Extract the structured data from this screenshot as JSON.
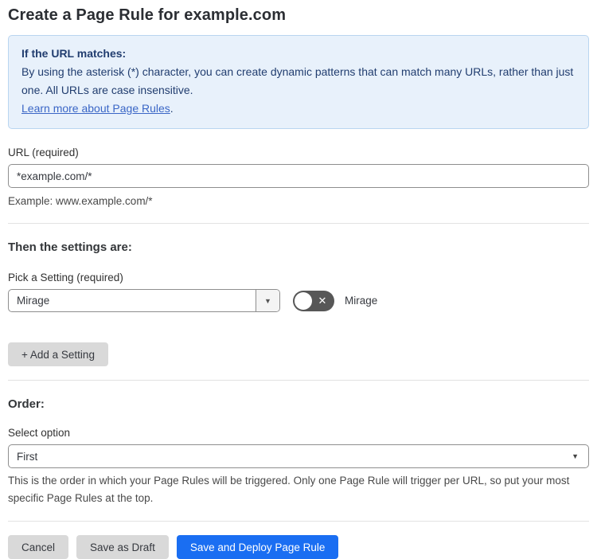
{
  "page": {
    "title": "Create a Page Rule for example.com"
  },
  "info_box": {
    "heading": "If the URL matches:",
    "body": "By using the asterisk (*) character, you can create dynamic patterns that can match many URLs, rather than just one. All URLs are case insensitive.",
    "link_label": "Learn more about Page Rules",
    "link_suffix": "."
  },
  "url_field": {
    "label": "URL (required)",
    "value": "*example.com/*",
    "helper": "Example: www.example.com/*"
  },
  "settings_section": {
    "heading": "Then the settings are:",
    "picker_label": "Pick a Setting (required)",
    "picker_value": "Mirage",
    "toggle_state": "off",
    "toggle_glyph": "✕",
    "toggle_label": "Mirage",
    "add_button_label": "+ Add a Setting"
  },
  "order_section": {
    "heading": "Order:",
    "select_label": "Select option",
    "select_value": "First",
    "helper": "This is the order in which your Page Rules will be triggered. Only one Page Rule will trigger per URL, so put your most specific Page Rules at the top."
  },
  "footer": {
    "cancel_label": "Cancel",
    "save_draft_label": "Save as Draft",
    "save_deploy_label": "Save and Deploy Page Rule"
  },
  "colors": {
    "accent_blue": "#1a6ef2",
    "info_background": "#e8f1fb",
    "info_border": "#b9d5f0",
    "info_text": "#213d6f",
    "link_blue": "#3a66c6",
    "toggle_off_gray": "#575757",
    "button_gray": "#d9d9d9",
    "divider_gray": "#e2e2e2"
  }
}
